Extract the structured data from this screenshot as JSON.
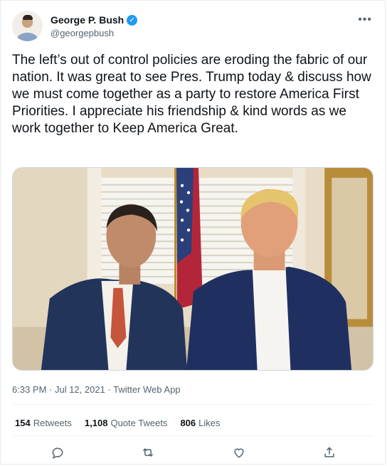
{
  "tweet": {
    "author": {
      "name": "George P. Bush",
      "handle": "@georgepbush",
      "verified": true
    },
    "text": "The left’s out of control policies are eroding the fabric of our nation. It was great to see Pres. Trump today & discuss how we must come together as a party to restore America First Priorities. I appreciate his friendship & kind words as we work together to Keep America Great.",
    "timestamp": "6:33 PM · Jul 12, 2021 · Twitter Web App",
    "stats": {
      "retweets": {
        "count": "154",
        "label": "Retweets"
      },
      "quote_tweets": {
        "count": "1,108",
        "label": "Quote Tweets"
      },
      "likes": {
        "count": "806",
        "label": "Likes"
      }
    },
    "icons": {
      "verified": "verified-badge-icon",
      "more": "more-options-icon",
      "reply": "reply-icon",
      "retweet": "retweet-icon",
      "like": "like-icon",
      "share": "share-icon"
    },
    "colors": {
      "accent": "#1d9bf0",
      "secondary_text": "#536471",
      "primary_text": "#0f1419"
    }
  }
}
